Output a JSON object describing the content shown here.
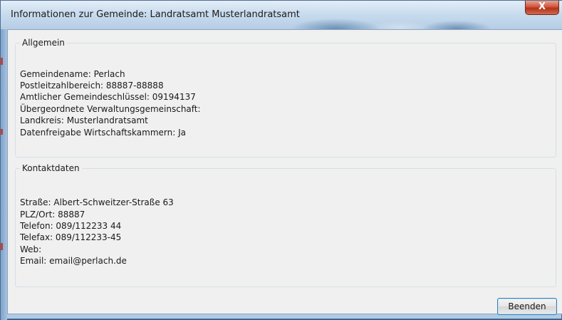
{
  "window": {
    "title": "Informationen zur Gemeinde: Landratsamt Musterlandratsamt",
    "close_label": "X"
  },
  "allgemein": {
    "legend": "Allgemein",
    "lines": [
      "Gemeindename: Perlach",
      "Postleitzahlbereich: 88887-88888",
      "Amtlicher Gemeindeschlüssel: 09194137",
      "Übergeordnete Verwaltungsgemeinschaft:",
      "Landkreis: Musterlandratsamt",
      "Datenfreigabe Wirtschaftskammern: Ja"
    ]
  },
  "kontakt": {
    "legend": "Kontaktdaten",
    "lines": [
      "Straße: Albert-Schweitzer-Straße 63",
      "PLZ/Ort: 88887",
      "Telefon: 089/112233 44",
      "Telefax: 089/112233-45",
      "Web:",
      "Email: email@perlach.de"
    ]
  },
  "actions": {
    "close_button_label": "Beenden"
  },
  "colors": {
    "titlebar": "#c9dcee",
    "client_background": "#f0f0f0",
    "close_button": "#c8452d",
    "button_border": "#3c7fb1"
  },
  "icons": {
    "close": "close-icon"
  }
}
